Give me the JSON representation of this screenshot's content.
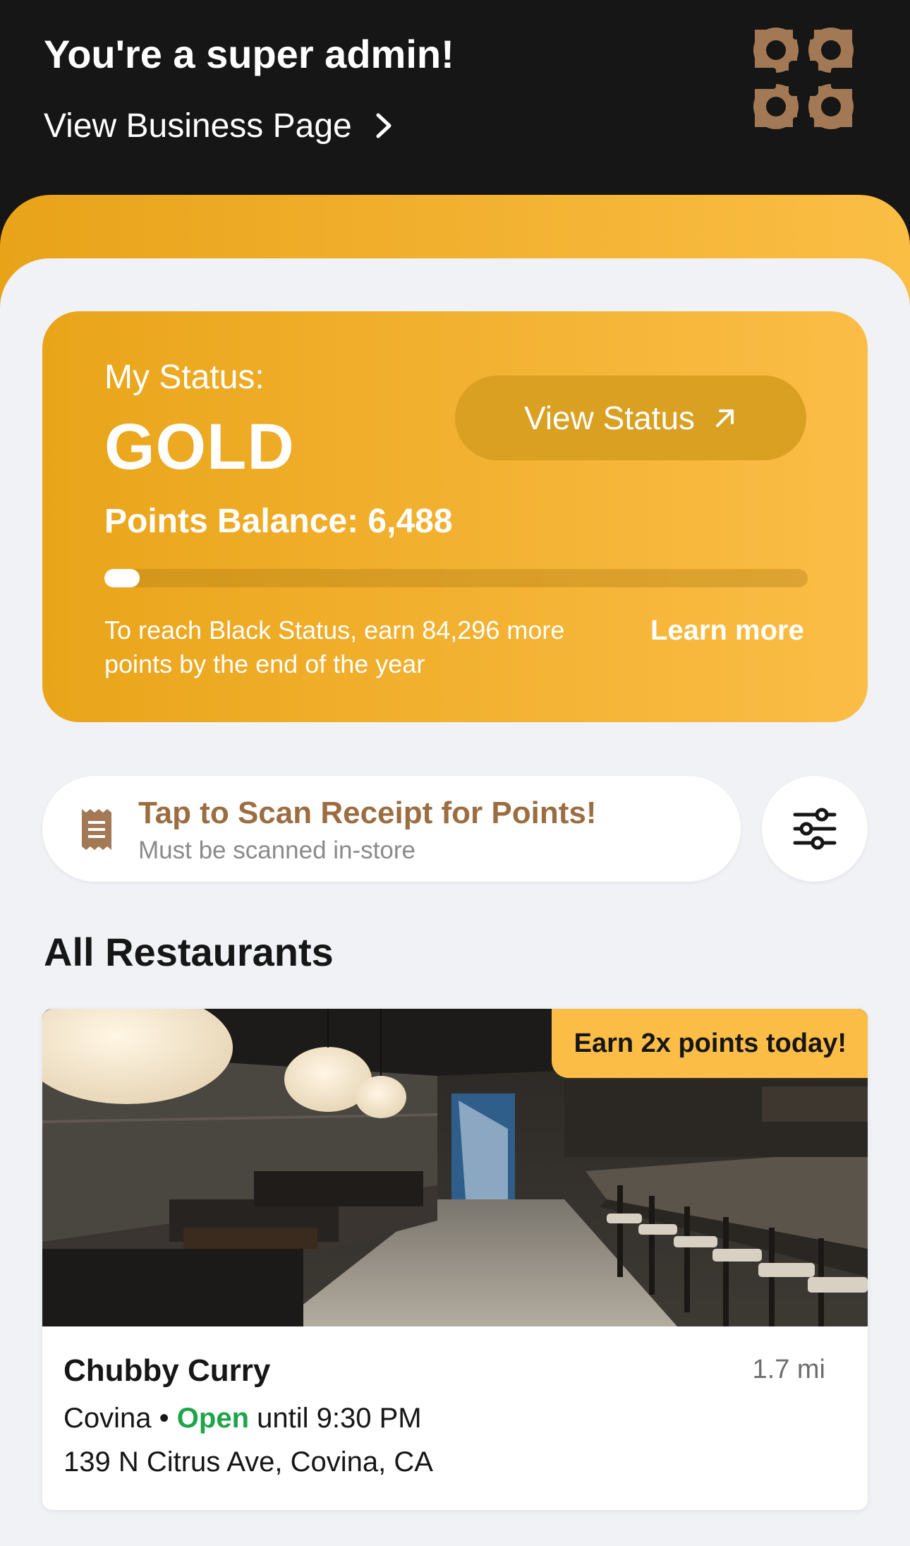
{
  "header": {
    "title": "You're a super admin!",
    "business_link": "View Business Page",
    "logo_icon": "clover-cross-logo"
  },
  "status": {
    "label": "My Status:",
    "level": "GOLD",
    "view_status_label": "View Status",
    "points_balance": "Points Balance: 6,488",
    "progress_fraction": 0.05,
    "reach_text": "To reach Black Status, earn 84,296 more points by the end of the year",
    "learn_more": "Learn more"
  },
  "scan": {
    "title": "Tap to Scan Receipt for Points!",
    "subtitle": "Must be scanned in-store",
    "icon": "receipt-icon",
    "filter_icon": "sliders-icon"
  },
  "restaurants": {
    "section_title": "All Restaurants",
    "items": [
      {
        "promo": "Earn 2x points today!",
        "name": "Chubby Curry",
        "distance": "1.7 mi",
        "city": "Covina",
        "separator": "•",
        "open_label": "Open",
        "hours": "until 9:30 PM",
        "address": "139 N Citrus Ave, Covina, CA"
      }
    ]
  },
  "colors": {
    "header_bg": "#161616",
    "gold_start": "#e9a51a",
    "gold_end": "#fbbd46",
    "sheet_bg": "#f0f2f6",
    "brown_accent": "#9b6e42",
    "open_green": "#1ea54a"
  }
}
